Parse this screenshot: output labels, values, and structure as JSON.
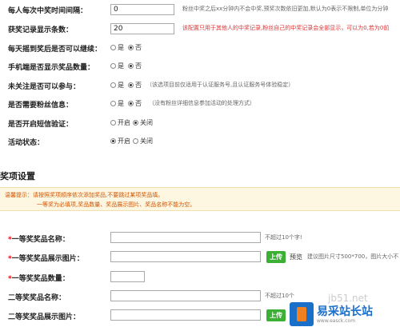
{
  "settings": {
    "interval": {
      "label": "每人每次中奖时间间隔：",
      "value": "0",
      "hint": "粉丝中奖之后xx分钟内不会中奖,预奖次数依旧更加,默认为0表示不限制,单位为分钟"
    },
    "record_count": {
      "label": "获奖记录显示条数：",
      "value": "20",
      "hint": "该配置只用于其他人的中奖记录,粉丝自己的中奖记录会全部显示，可以为0,若为0前"
    },
    "continue_after_win": {
      "label": "每天摇到奖后是否可以继续：",
      "opt_yes": "是",
      "opt_no": "否",
      "selected": "no"
    },
    "mobile_show_count": {
      "label": "手机端是否显示奖品数量：",
      "opt_yes": "是",
      "opt_no": "否",
      "selected": "no"
    },
    "unfollowed_join": {
      "label": "未关注是否可以参与：",
      "opt_yes": "是",
      "opt_no": "否",
      "selected": "no",
      "hint": "（该选项目前仅适用于认证服务号,且认证服务号体验稳定）"
    },
    "need_fan_info": {
      "label": "是否需要粉丝信息：",
      "opt_yes": "是",
      "opt_no": "否",
      "selected": "no",
      "hint": "（没有粉丝详细信息参加活动的处理方式）"
    },
    "sms_verify": {
      "label": "是否开启短信验证：",
      "opt_on": "开启",
      "opt_off": "关闭",
      "selected": "off"
    },
    "activity_status": {
      "label": "活动状态：",
      "opt_on": "开启",
      "opt_off": "关闭",
      "selected": "on"
    }
  },
  "prize_section": {
    "title": "奖项设置",
    "tip_line1": "温馨提示：请按照奖项顺序依次添加奖品,不要跳过某项奖品填。",
    "tip_line2": "一等奖为必填项,奖品数量、奖品展示图片、奖品名称不能为空。",
    "first_name": {
      "star": "*",
      "label": "一等奖奖品名称：",
      "hint": "不超过10个字!"
    },
    "first_image": {
      "star": "*",
      "label": "一等奖奖品展示图片：",
      "upload": "上传",
      "preview": "预览",
      "hint": "建议图片尺寸500*700，图片大小不"
    },
    "first_count": {
      "star": "*",
      "label": "一等奖奖品数量："
    },
    "second_name": {
      "label": "二等奖奖品名称：",
      "hint": "不超过10个"
    },
    "second_image": {
      "label": "二等奖奖品展示图片：",
      "upload": "上传"
    }
  },
  "watermark": {
    "site_url": "jb51.net",
    "brand": "易采站长站",
    "brand_url": "www.easck.com"
  }
}
